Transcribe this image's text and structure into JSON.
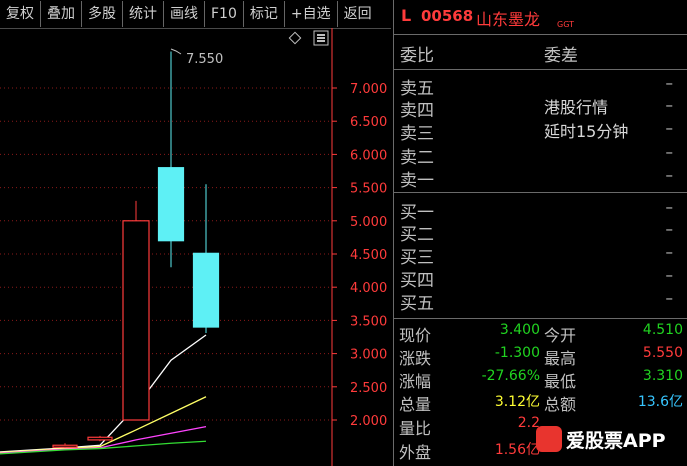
{
  "toolbar": [
    {
      "label": "复权"
    },
    {
      "label": "叠加"
    },
    {
      "label": "多股"
    },
    {
      "label": "统计"
    },
    {
      "label": "画线"
    },
    {
      "label": "F10"
    },
    {
      "label": "标记"
    },
    {
      "label": "+自选"
    },
    {
      "label": "返回"
    }
  ],
  "chart_icons": [
    "diamond-icon",
    "menu-icon"
  ],
  "chart_data": {
    "type": "candlestick",
    "y_ticks": [
      "7.000",
      "6.500",
      "6.000",
      "5.500",
      "5.000",
      "4.500",
      "4.000",
      "3.500",
      "3.000",
      "2.500",
      "2.000"
    ],
    "peak_label": "7.550",
    "candles": [
      {
        "open": 1.6,
        "close": 1.62,
        "high": 1.65,
        "low": 1.58
      },
      {
        "open": 1.7,
        "close": 1.74,
        "high": 1.76,
        "low": 1.68
      },
      {
        "open": 2.0,
        "close": 5.0,
        "high": 5.3,
        "low": 2.0
      },
      {
        "open": 5.8,
        "close": 4.7,
        "high": 7.55,
        "low": 4.3
      },
      {
        "open": 4.51,
        "close": 3.4,
        "high": 5.55,
        "low": 3.31
      }
    ],
    "ma_lines": [
      {
        "color": "#ffffff",
        "values": [
          1.58,
          1.62,
          2.2,
          2.9,
          3.28
        ]
      },
      {
        "color": "#ffff66",
        "values": [
          1.57,
          1.6,
          1.85,
          2.1,
          2.35
        ]
      },
      {
        "color": "#ff44ff",
        "values": [
          1.56,
          1.58,
          1.7,
          1.8,
          1.9
        ]
      },
      {
        "color": "#33dd33",
        "values": [
          1.55,
          1.57,
          1.61,
          1.65,
          1.68
        ]
      }
    ],
    "colors": {
      "up": "#ff3b3b",
      "down": "#5ef0f5",
      "axis": "#ff3b3b",
      "grid": "#8a1a1a"
    }
  },
  "stock": {
    "prefix": "L",
    "code": "00568",
    "name": "山东墨龙",
    "tag": "GGT"
  },
  "order_book": {
    "weibi_label": "委比",
    "weicha_label": "委差",
    "sells": [
      {
        "label": "卖五",
        "value": "–"
      },
      {
        "label": "卖四",
        "value": "–"
      },
      {
        "label": "卖三",
        "value": "–"
      },
      {
        "label": "卖二",
        "value": "–"
      },
      {
        "label": "卖一",
        "value": "–"
      }
    ],
    "buys": [
      {
        "label": "买一",
        "value": "–"
      },
      {
        "label": "买二",
        "value": "–"
      },
      {
        "label": "买三",
        "value": "–"
      },
      {
        "label": "买四",
        "value": "–"
      },
      {
        "label": "买五",
        "value": "–"
      }
    ],
    "notice_line1": "港股行情",
    "notice_line2": "延时15分钟"
  },
  "quote": {
    "rows": [
      {
        "l1": "现价",
        "v1": "3.400",
        "c1": "green",
        "l2": "今开",
        "v2": "4.510",
        "c2": "green"
      },
      {
        "l1": "涨跌",
        "v1": "-1.300",
        "c1": "green",
        "l2": "最高",
        "v2": "5.550",
        "c2": "red"
      },
      {
        "l1": "涨幅",
        "v1": "-27.66%",
        "c1": "green",
        "l2": "最低",
        "v2": "3.310",
        "c2": "green"
      },
      {
        "l1": "总量",
        "v1": "3.12亿",
        "c1": "yellow",
        "l2": "总额",
        "v2": "13.6亿",
        "c2": "cyan"
      },
      {
        "l1": "量比",
        "v1": "2.2",
        "c1": "red",
        "l2": "",
        "v2": "",
        "c2": "red"
      },
      {
        "l1": "外盘",
        "v1": "1.56亿",
        "c1": "red",
        "l2": "",
        "v2": "",
        "c2": "red"
      }
    ]
  },
  "watermark": {
    "text": "爱股票APP"
  }
}
